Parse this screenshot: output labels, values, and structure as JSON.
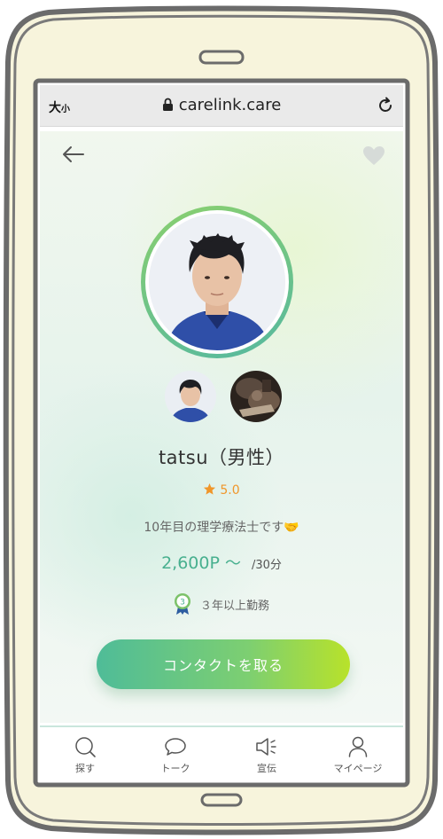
{
  "browser": {
    "text_size_big": "大",
    "text_size_small": "小",
    "url": "carelink.care"
  },
  "profile": {
    "name": "tatsu（男性）",
    "rating": "5.0",
    "bio": "10年目の理学療法士です🤝",
    "price_amount": "2,600P",
    "price_tilde": "〜",
    "price_unit": "/30分",
    "experience": "３年以上勤務",
    "experience_badge_number": "3",
    "cta_label": "コンタクトを取る"
  },
  "tabs": [
    {
      "label": "探す",
      "icon": "search-icon"
    },
    {
      "label": "トーク",
      "icon": "chat-bubble-icon"
    },
    {
      "label": "宣伝",
      "icon": "megaphone-icon"
    },
    {
      "label": "マイページ",
      "icon": "person-icon"
    }
  ],
  "colors": {
    "accent_green": "#48b08f",
    "rating_orange": "#f0962a",
    "cta_gradient_start": "#4fbc98",
    "cta_gradient_end": "#b8e22a",
    "frame_fill": "#f7f4dc",
    "frame_stroke": "#6b6b6b"
  }
}
